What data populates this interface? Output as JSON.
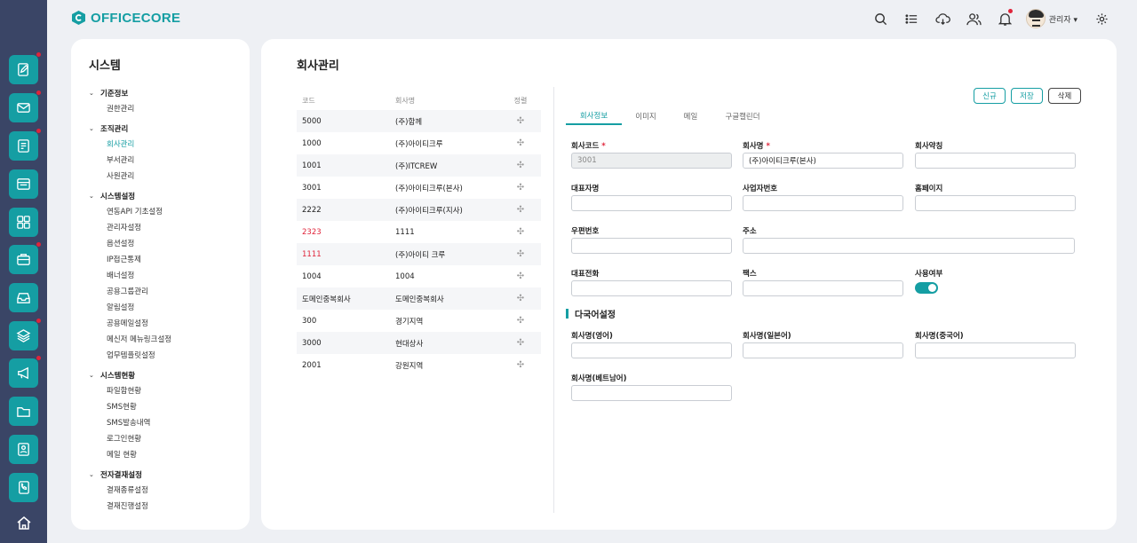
{
  "brand": {
    "name": "OFFICECORE"
  },
  "topbar": {
    "user_name": "관리자 ▾"
  },
  "rail": {
    "items": [
      {
        "icon": "note-edit-icon",
        "dot": true
      },
      {
        "icon": "mail-icon",
        "dot": true
      },
      {
        "icon": "approval-doc-icon",
        "dot": true
      },
      {
        "icon": "board-icon",
        "dot": false
      },
      {
        "icon": "apps-grid-icon",
        "dot": false
      },
      {
        "icon": "briefcase-icon",
        "dot": true
      },
      {
        "icon": "inbox-icon",
        "dot": false
      },
      {
        "icon": "layers-icon",
        "dot": true
      },
      {
        "icon": "megaphone-icon",
        "dot": true
      },
      {
        "icon": "folder-icon",
        "dot": false
      },
      {
        "icon": "contact-icon",
        "dot": false
      },
      {
        "icon": "phonebook-icon",
        "dot": false
      }
    ]
  },
  "sidebar": {
    "title": "시스템",
    "groups": [
      {
        "label": "기준정보",
        "items": [
          "권한관리"
        ]
      },
      {
        "label": "조직관리",
        "items": [
          "회사관리",
          "부서관리",
          "사원관리"
        ]
      },
      {
        "label": "시스템설정",
        "items": [
          "연동API 기초설정",
          "관리자설정",
          "옵션설정",
          "IP접근통제",
          "배너설정",
          "공용그룹관리",
          "알림설정",
          "공용메일설정",
          "메신저 메뉴링크설정",
          "업무템플릿설정"
        ]
      },
      {
        "label": "시스템현황",
        "items": [
          "파일함현황",
          "SMS현황",
          "SMS발송내역",
          "로그인현황",
          "메일 현황"
        ]
      },
      {
        "label": "전자결재설정",
        "items": [
          "결재종류설정",
          "결재진행설정"
        ]
      }
    ]
  },
  "main": {
    "title": "회사관리",
    "list": {
      "headers": [
        "코드",
        "회사명",
        "정렬"
      ],
      "rows": [
        {
          "code": "5000",
          "name": "(주)함께",
          "red": false
        },
        {
          "code": "1000",
          "name": "(주)아이티크루",
          "red": false
        },
        {
          "code": "1001",
          "name": "(주)ITCREW",
          "red": false
        },
        {
          "code": "3001",
          "name": "(주)아이티크루(본사)",
          "red": false
        },
        {
          "code": "2222",
          "name": "(주)아이티크루(지사)",
          "red": false
        },
        {
          "code": "2323",
          "name": "1111",
          "red": true
        },
        {
          "code": "1111",
          "name": "(주)아이티 크루",
          "red": true
        },
        {
          "code": "1004",
          "name": "1004",
          "red": false
        },
        {
          "code": "도메인중복회사",
          "name": "도메인중복회사",
          "red": false
        },
        {
          "code": "300",
          "name": "경기지역",
          "red": false
        },
        {
          "code": "3000",
          "name": "현대상사",
          "red": false
        },
        {
          "code": "2001",
          "name": "강원지역",
          "red": false
        }
      ]
    },
    "buttons": {
      "new": "신규",
      "save": "저장",
      "delete": "삭제"
    },
    "tabs": [
      "회사정보",
      "이미지",
      "메일",
      "구글캘린더"
    ],
    "form": {
      "company_code": {
        "label": "회사코드",
        "value": "3001"
      },
      "company_name": {
        "label": "회사명",
        "value": "(주)아이티크루(본사)"
      },
      "short_name": {
        "label": "회사약칭",
        "value": ""
      },
      "ceo": {
        "label": "대표자명",
        "value": ""
      },
      "biz_no": {
        "label": "사업자번호",
        "value": ""
      },
      "homepage": {
        "label": "홈페이지",
        "value": ""
      },
      "zip": {
        "label": "우편번호",
        "value": ""
      },
      "address": {
        "label": "주소",
        "value": ""
      },
      "phone": {
        "label": "대표전화",
        "value": ""
      },
      "fax": {
        "label": "팩스",
        "value": ""
      },
      "use": {
        "label": "사용여부",
        "on": true
      }
    },
    "i18n": {
      "title": "다국어설정",
      "en": {
        "label": "회사명(영어)",
        "value": ""
      },
      "ja": {
        "label": "회사명(일본어)",
        "value": ""
      },
      "zh": {
        "label": "회사명(중국어)",
        "value": ""
      },
      "vi": {
        "label": "회사명(베트남어)",
        "value": ""
      }
    }
  },
  "colors": {
    "accent": "#159ea3",
    "rail": "#3a4566",
    "alert": "#e0243a"
  }
}
